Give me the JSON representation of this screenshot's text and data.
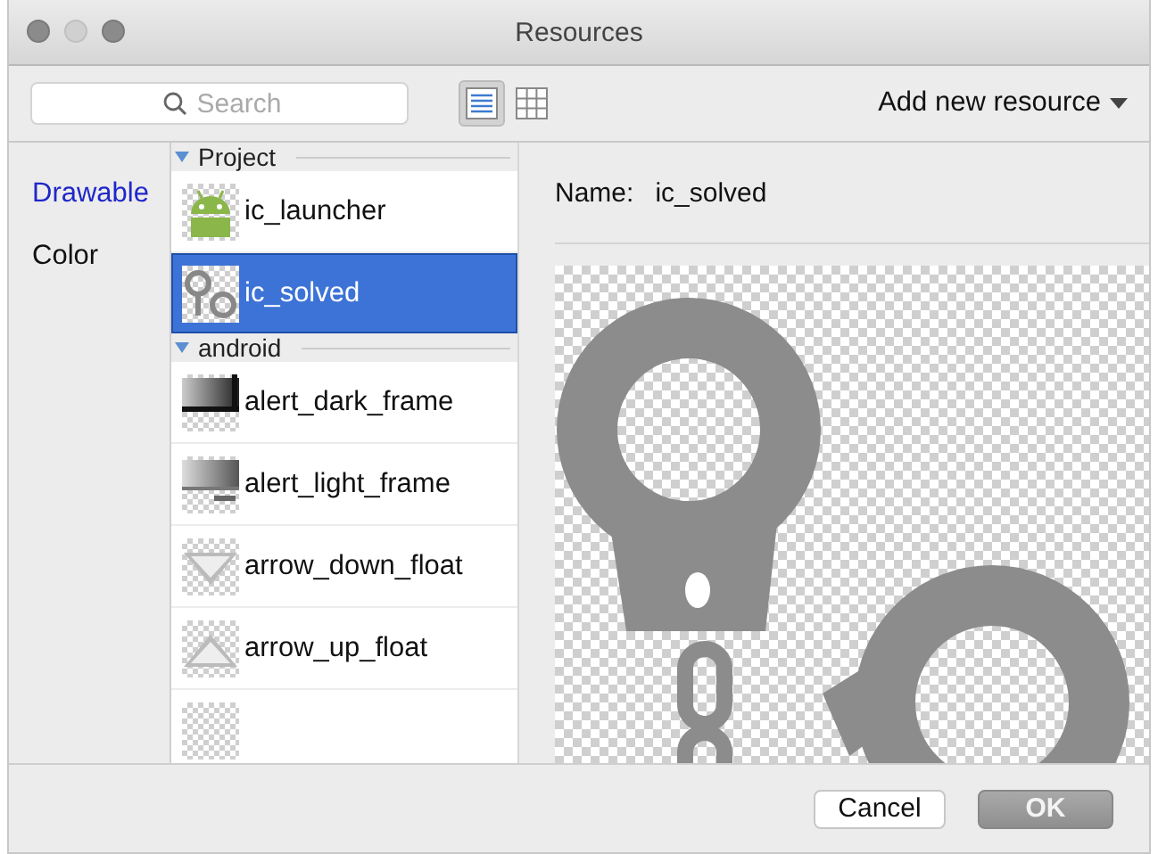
{
  "window": {
    "title": "Resources"
  },
  "toolbar": {
    "search": {
      "placeholder": "Search"
    },
    "view_modes": [
      {
        "kind": "list",
        "selected": true
      },
      {
        "kind": "grid",
        "selected": false
      }
    ],
    "add_menu": "Add new resource"
  },
  "categories": [
    {
      "label": "Drawable",
      "selected": true
    },
    {
      "label": "Color",
      "selected": false
    }
  ],
  "groups": [
    {
      "name": "Project",
      "expanded": true,
      "items": [
        {
          "name": "ic_launcher",
          "kind": "android",
          "selected": false
        },
        {
          "name": "ic_solved",
          "kind": "handcuffs",
          "selected": true
        }
      ]
    },
    {
      "name": "android",
      "expanded": true,
      "items": [
        {
          "name": "alert_dark_frame",
          "kind": "dark_frame",
          "selected": false
        },
        {
          "name": "alert_light_frame",
          "kind": "light_frame",
          "selected": false
        },
        {
          "name": "arrow_down_float",
          "kind": "arrow_down",
          "selected": false
        },
        {
          "name": "arrow_up_float",
          "kind": "arrow_up",
          "selected": false
        },
        {
          "kind": "blank",
          "selected": false
        }
      ]
    }
  ],
  "preview": {
    "name_label": "Name:",
    "name_value": "ic_solved"
  },
  "buttons": [
    {
      "label": "Cancel",
      "default": false
    },
    {
      "label": "OK",
      "default": true
    }
  ]
}
